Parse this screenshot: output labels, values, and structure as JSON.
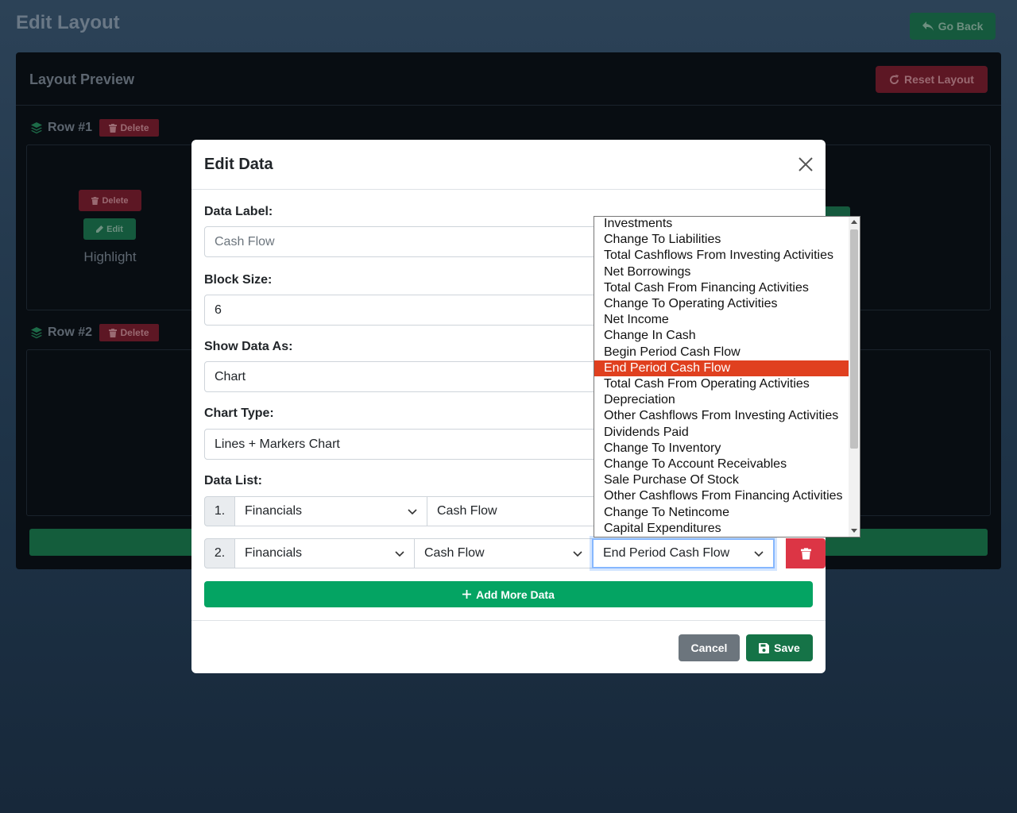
{
  "page": {
    "title": "Edit Layout",
    "go_back_label": "Go Back"
  },
  "layout_preview": {
    "title": "Layout Preview",
    "reset_label": "Reset Layout",
    "rows": [
      {
        "label": "Row #1",
        "delete_label": "Delete"
      },
      {
        "label": "Row #2",
        "delete_label": "Delete"
      }
    ],
    "block": {
      "delete_label": "Delete",
      "edit_label": "Edit",
      "name": "Highlight"
    }
  },
  "modal": {
    "title": "Edit Data",
    "data_label": {
      "label": "Data Label:",
      "value": "Cash Flow"
    },
    "block_size": {
      "label": "Block Size:",
      "value": "6"
    },
    "show_data_as": {
      "label": "Show Data As:",
      "value": "Chart"
    },
    "chart_type": {
      "label": "Chart Type:",
      "value": "Lines + Markers Chart"
    },
    "data_list": {
      "label": "Data List:",
      "rows": [
        {
          "index": "1.",
          "source": "Financials",
          "statement": "Cash Flow",
          "item": ""
        },
        {
          "index": "2.",
          "source": "Financials",
          "statement": "Cash Flow",
          "item": "End Period Cash Flow"
        }
      ]
    },
    "add_more_label": "Add More Data",
    "cancel_label": "Cancel",
    "save_label": "Save"
  },
  "dropdown": {
    "selected_index": 9,
    "options": [
      "Investments",
      "Change To Liabilities",
      "Total Cashflows From Investing Activities",
      "Net Borrowings",
      "Total Cash From Financing Activities",
      "Change To Operating Activities",
      "Net Income",
      "Change In Cash",
      "Begin Period Cash Flow",
      "End Period Cash Flow",
      "Total Cash From Operating Activities",
      "Depreciation",
      "Other Cashflows From Investing Activities",
      "Dividends Paid",
      "Change To Inventory",
      "Change To Account Receivables",
      "Sale Purchase Of Stock",
      "Other Cashflows From Financing Activities",
      "Change To Netincome",
      "Capital Expenditures"
    ]
  },
  "colors": {
    "success": "#04a463",
    "danger": "#dc3545",
    "secondary": "#6c757d",
    "highlight": "#e0401f"
  }
}
